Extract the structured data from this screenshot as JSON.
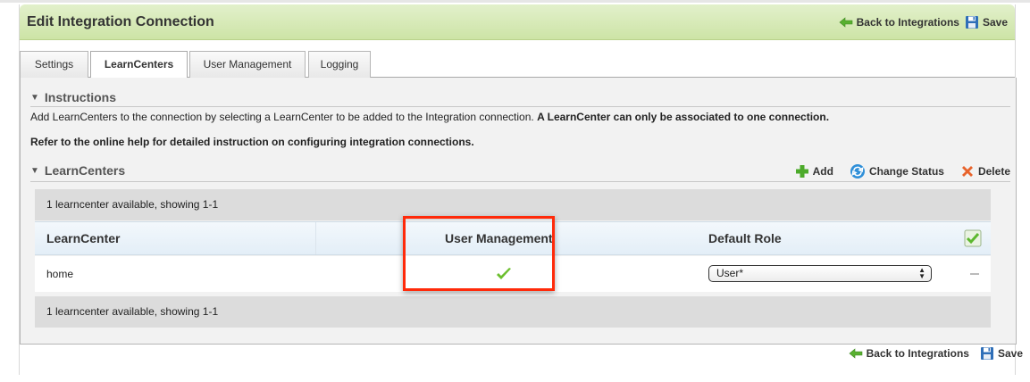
{
  "header": {
    "title": "Edit Integration Connection",
    "back_label": "Back to Integrations",
    "save_label": "Save"
  },
  "tabs": [
    {
      "label": "Settings",
      "active": false
    },
    {
      "label": "LearnCenters",
      "active": true
    },
    {
      "label": "User Management",
      "active": false
    },
    {
      "label": "Logging",
      "active": false
    }
  ],
  "instructions": {
    "title": "Instructions",
    "line1_normal": "Add LearnCenters to the connection by selecting a LearnCenter to be added to the Integration connection. ",
    "line1_bold": "A LearnCenter can only be associated to one connection.",
    "line2": "Refer to the online help for detailed instruction on configuring integration connections."
  },
  "learncenters": {
    "title": "LearnCenters",
    "toolbar": {
      "add_label": "Add",
      "change_status_label": "Change Status",
      "delete_label": "Delete"
    },
    "pager_top": "1 learncenter available, showing 1-1",
    "pager_bottom": "1 learncenter available, showing 1-1",
    "columns": [
      "LearnCenter",
      "User Management",
      "Default Role"
    ],
    "rows": [
      {
        "learncenter": "home",
        "user_management": true,
        "default_role": "User*",
        "selected": false
      }
    ]
  },
  "footer": {
    "back_label": "Back to Integrations",
    "save_label": "Save"
  },
  "colors": {
    "header_green": "#cde4a6",
    "highlight_red": "#ff2a0a",
    "check_green": "#6cbf2e"
  }
}
